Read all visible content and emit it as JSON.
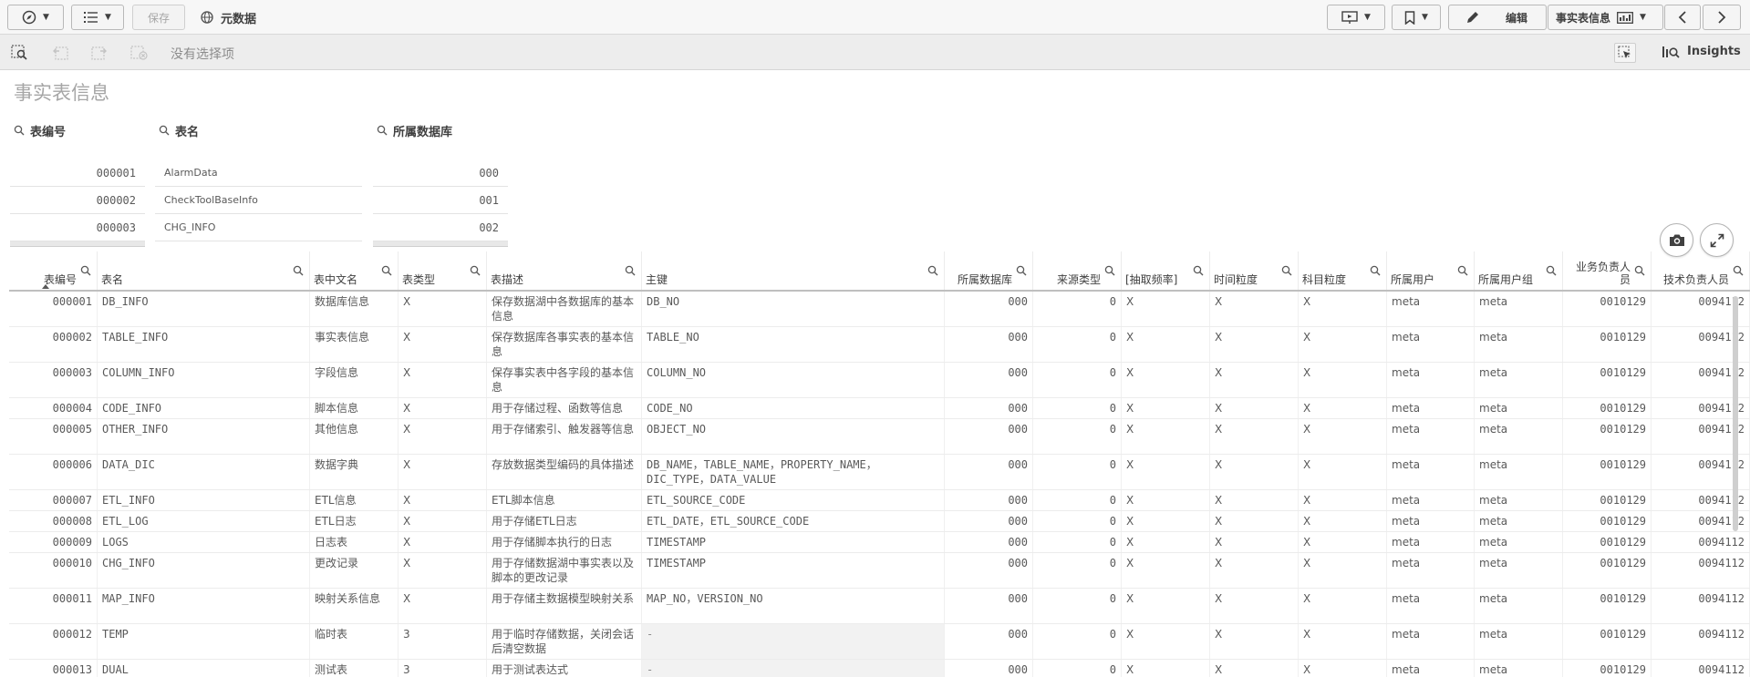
{
  "toolbar": {
    "save_label": "保存",
    "app_name": "元数据",
    "edit_label": "编辑",
    "sheet_selector": "事实表信息"
  },
  "selection_bar": {
    "no_selection": "没有选择项",
    "insights_label": "Insights"
  },
  "sheet": {
    "title": "事实表信息"
  },
  "filters": [
    {
      "title": "表编号",
      "values": [
        "000001",
        "000002",
        "000003"
      ]
    },
    {
      "title": "表名",
      "values": [
        "AlarmData",
        "CheckToolBaseInfo",
        "CHG_INFO"
      ]
    },
    {
      "title": "所属数据库",
      "values": [
        "000",
        "001",
        "002"
      ]
    }
  ],
  "table": {
    "headers": [
      "表编号",
      "表名",
      "表中文名",
      "表类型",
      "表描述",
      "主键",
      "所属数据库",
      "来源类型",
      "[抽取频率]",
      "时间粒度",
      "科目粒度",
      "所属用户",
      "所属用户组",
      "业务负责人员",
      "技术负责人员"
    ],
    "rows": [
      [
        "000001",
        "DB_INFO",
        "数据库信息",
        "X",
        "保存数据湖中各数据库的基本信息",
        "DB_NO",
        "000",
        "0",
        "X",
        "X",
        "X",
        "meta",
        "meta",
        "0010129",
        "0094112"
      ],
      [
        "000002",
        "TABLE_INFO",
        "事实表信息",
        "X",
        "保存数据库各事实表的基本信息",
        "TABLE_NO",
        "000",
        "0",
        "X",
        "X",
        "X",
        "meta",
        "meta",
        "0010129",
        "0094112"
      ],
      [
        "000003",
        "COLUMN_INFO",
        "字段信息",
        "X",
        "保存事实表中各字段的基本信息",
        "COLUMN_NO",
        "000",
        "0",
        "X",
        "X",
        "X",
        "meta",
        "meta",
        "0010129",
        "0094112"
      ],
      [
        "000004",
        "CODE_INFO",
        "脚本信息",
        "X",
        "用于存储过程、函数等信息",
        "CODE_NO",
        "000",
        "0",
        "X",
        "X",
        "X",
        "meta",
        "meta",
        "0010129",
        "0094112"
      ],
      [
        "000005",
        "OTHER_INFO",
        "其他信息",
        "X",
        "用于存储索引、触发器等信息",
        "OBJECT_NO",
        "000",
        "0",
        "X",
        "X",
        "X",
        "meta",
        "meta",
        "0010129",
        "0094112"
      ],
      [
        "000006",
        "DATA_DIC",
        "数据字典",
        "X",
        "存放数据类型编码的具体描述",
        "DB_NAME，TABLE_NAME，PROPERTY_NAME，DIC_TYPE，DATA_VALUE",
        "000",
        "0",
        "X",
        "X",
        "X",
        "meta",
        "meta",
        "0010129",
        "0094112"
      ],
      [
        "000007",
        "ETL_INFO",
        "ETL信息",
        "X",
        "ETL脚本信息",
        "ETL_SOURCE_CODE",
        "000",
        "0",
        "X",
        "X",
        "X",
        "meta",
        "meta",
        "0010129",
        "0094112"
      ],
      [
        "000008",
        "ETL_LOG",
        "ETL日志",
        "X",
        "用于存储ETL日志",
        "ETL_DATE，ETL_SOURCE_CODE",
        "000",
        "0",
        "X",
        "X",
        "X",
        "meta",
        "meta",
        "0010129",
        "0094112"
      ],
      [
        "000009",
        "LOGS",
        "日志表",
        "X",
        "用于存储脚本执行的日志",
        "TIMESTAMP",
        "000",
        "0",
        "X",
        "X",
        "X",
        "meta",
        "meta",
        "0010129",
        "0094112"
      ],
      [
        "000010",
        "CHG_INFO",
        "更改记录",
        "X",
        "用于存储数据湖中事实表以及脚本的更改记录",
        "TIMESTAMP",
        "000",
        "0",
        "X",
        "X",
        "X",
        "meta",
        "meta",
        "0010129",
        "0094112"
      ],
      [
        "000011",
        "MAP_INFO",
        "映射关系信息",
        "X",
        "用于存储主数据模型映射关系",
        "MAP_NO，VERSION_NO",
        "000",
        "0",
        "X",
        "X",
        "X",
        "meta",
        "meta",
        "0010129",
        "0094112"
      ],
      [
        "000012",
        "TEMP",
        "临时表",
        "3",
        "用于临时存储数据，关闭会话后清空数据",
        "-",
        "000",
        "0",
        "X",
        "X",
        "X",
        "meta",
        "meta",
        "0010129",
        "0094112"
      ],
      [
        "000013",
        "DUAL",
        "测试表",
        "3",
        "用于测试表达式",
        "-",
        "000",
        "0",
        "X",
        "X",
        "X",
        "meta",
        "meta",
        "0010129",
        "0094112"
      ]
    ]
  }
}
